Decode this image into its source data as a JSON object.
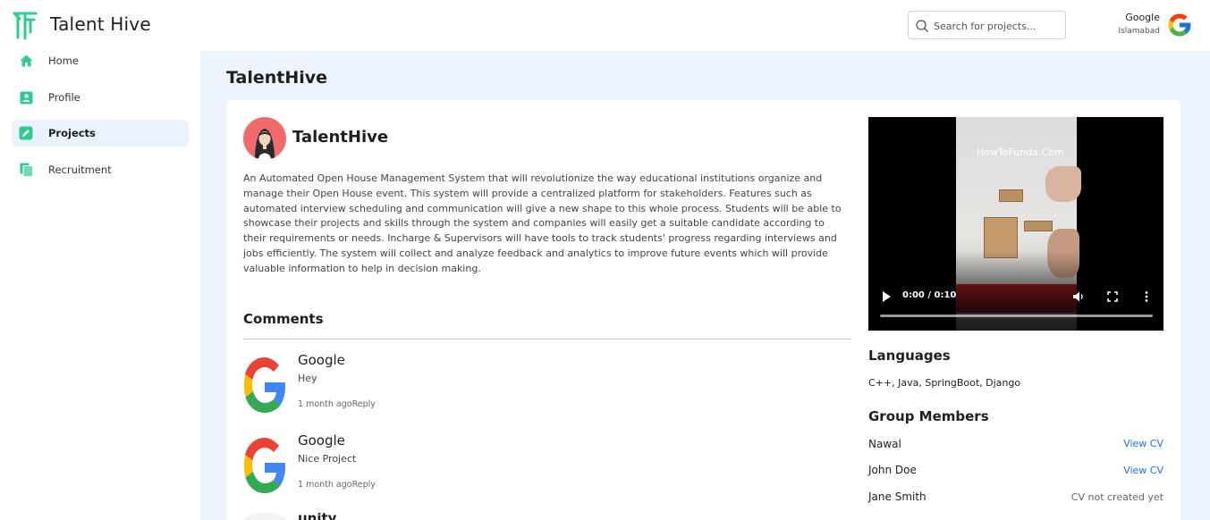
{
  "header": {
    "brand": "Talent Hive",
    "search_placeholder": "Search for projects...",
    "user": {
      "name": "Google",
      "location": "Islamabad"
    }
  },
  "sidebar": {
    "items": [
      {
        "label": "Home",
        "icon": "home-icon",
        "active": false
      },
      {
        "label": "Profile",
        "icon": "profile-icon",
        "active": false
      },
      {
        "label": "Projects",
        "icon": "edit-icon",
        "active": true
      },
      {
        "label": "Recruitment",
        "icon": "documents-icon",
        "active": false
      }
    ]
  },
  "main": {
    "page_title": "TalentHive",
    "project": {
      "name": "TalentHive",
      "description": "An Automated Open House Management System that will revolutionize the way educational institutions organize and manage their Open House event. This system will provide a centralized platform for stakeholders. Features such as automated interview scheduling and communication will give a new shape to this whole process. Students will be able to showcase their projects and skills through the system and companies will easily get a suitable candidate according to their requirements or needs. Incharge & Supervisors will have tools to track students' progress regarding interviews and jobs efficiently. The system will collect and analyze feedback and analytics to improve future events which will provide valuable information to help in decision making."
    },
    "comments": {
      "title": "Comments",
      "items": [
        {
          "author": "Google",
          "text": "Hey",
          "time": "1 month ago",
          "reply": "Reply"
        },
        {
          "author": "Google",
          "text": "Nice Project",
          "time": "1 month ago",
          "reply": "Reply"
        },
        {
          "author": "unity",
          "text": "",
          "time": "",
          "reply": ""
        }
      ]
    },
    "video": {
      "watermark": "HowToFunda.Com",
      "time": "0:00 / 0:10",
      "progress": 0
    },
    "languages": {
      "title": "Languages",
      "value": "C++, Java, SpringBoot, Django"
    },
    "group": {
      "title": "Group Members",
      "members": [
        {
          "name": "Nawal",
          "cv": "View CV"
        },
        {
          "name": "John Doe",
          "cv": "View CV"
        },
        {
          "name": "Jane Smith",
          "cv": "CV not created yet"
        }
      ]
    }
  },
  "colors": {
    "accent": "#2ecc8f",
    "link": "#1a73e8",
    "main_bg": "#eef4fd",
    "active_nav_bg": "#eaf2fe"
  }
}
